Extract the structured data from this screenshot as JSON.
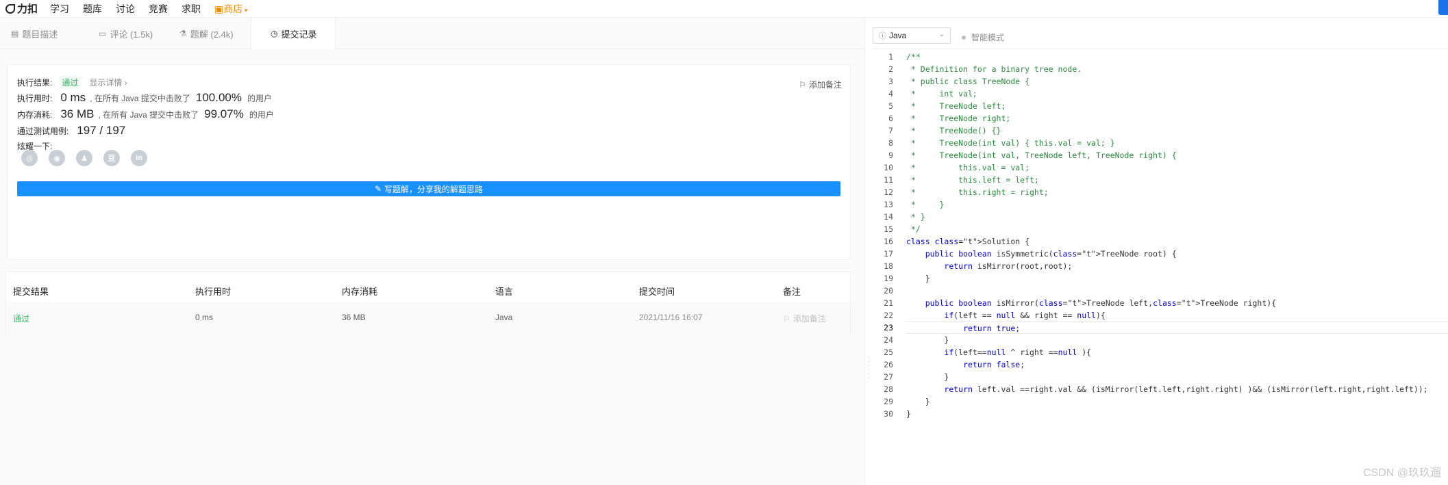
{
  "topnav": {
    "brand": "力扣",
    "links": [
      "学习",
      "题库",
      "讨论",
      "竞赛",
      "求职"
    ],
    "shop": "商店",
    "colors": {
      "shop": "#f08c00"
    }
  },
  "tabs": [
    {
      "label": "题目描述",
      "icon": "description-icon"
    },
    {
      "label": "评论 (1.5k)",
      "icon": "comment-icon"
    },
    {
      "label": "题解 (2.4k)",
      "icon": "flask-icon"
    },
    {
      "label": "提交记录",
      "icon": "clock-icon",
      "active": true
    }
  ],
  "result": {
    "status_label": "执行结果:",
    "status_value": "通过",
    "detail_link": "显示详情 ›",
    "add_note": "添加备注",
    "runtime_label": "执行用时:",
    "runtime_value": "0 ms",
    "runtime_beat_prefix": ", 在所有 Java 提交中击败了",
    "runtime_beat_value": "100.00%",
    "runtime_beat_suffix": "的用户",
    "memory_label": "内存消耗:",
    "memory_value": "36 MB",
    "memory_beat_prefix": ", 在所有 Java 提交中击败了",
    "memory_beat_value": "99.07%",
    "memory_beat_suffix": "的用户",
    "testcases_label": "通过测试用例:",
    "testcases_value": "197 / 197",
    "share_label": "炫耀一下:",
    "share_icons": [
      "wechat-icon",
      "weibo-icon",
      "qq-icon",
      "douban-icon",
      "linkedin-icon"
    ],
    "write_button": "写题解，分享我的解题思路",
    "colors": {
      "pass": "#2db55d",
      "primary": "#1890ff"
    }
  },
  "submissions": {
    "headers": [
      "提交结果",
      "执行用时",
      "内存消耗",
      "语言",
      "提交时间",
      "备注"
    ],
    "rows": [
      {
        "result": "通过",
        "runtime": "0 ms",
        "memory": "36 MB",
        "language": "Java",
        "time": "2021/11/16 16:07",
        "note": "添加备注"
      }
    ]
  },
  "editor": {
    "language": "Java",
    "smart_mode": "智能模式",
    "active_line": 23,
    "lines": [
      "/**",
      " * Definition for a binary tree node.",
      " * public class TreeNode {",
      " *     int val;",
      " *     TreeNode left;",
      " *     TreeNode right;",
      " *     TreeNode() {}",
      " *     TreeNode(int val) { this.val = val; }",
      " *     TreeNode(int val, TreeNode left, TreeNode right) {",
      " *         this.val = val;",
      " *         this.left = left;",
      " *         this.right = right;",
      " *     }",
      " * }",
      " */",
      "class Solution {",
      "    public boolean isSymmetric(TreeNode root) {",
      "        return isMirror(root,root);",
      "    }",
      "",
      "    public boolean isMirror(TreeNode left,TreeNode right){",
      "        if(left == null && right == null){",
      "            return true;",
      "        }",
      "        if(left==null ^ right ==null ){",
      "            return false;",
      "        }",
      "        return left.val ==right.val && (isMirror(left.left,right.right) )&& (isMirror(left.right,right.left));",
      "    }",
      "}"
    ]
  },
  "watermark": "CSDN @玖玖遛"
}
